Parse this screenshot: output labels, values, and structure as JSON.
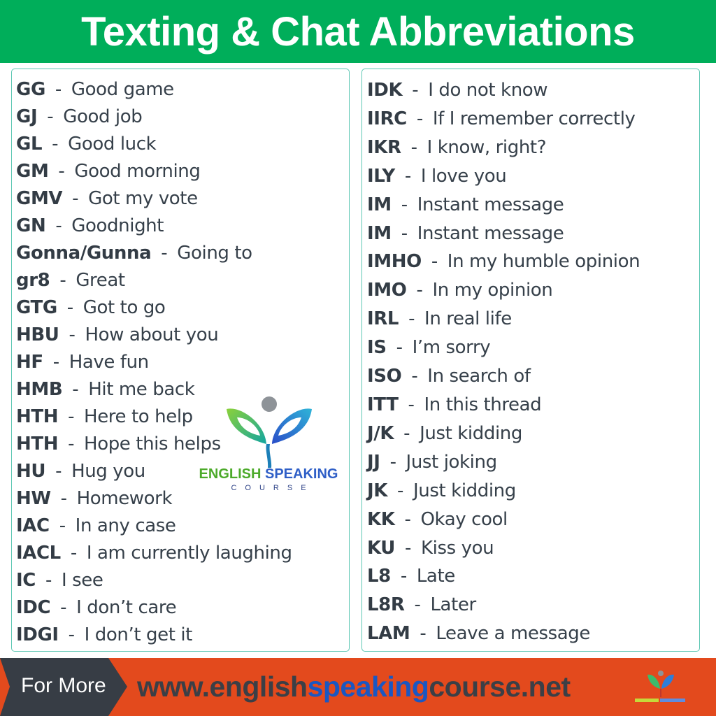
{
  "header": {
    "title": "Texting & Chat Abbreviations"
  },
  "columns": {
    "left": [
      {
        "abbr": "GG",
        "meaning": "Good game"
      },
      {
        "abbr": "GJ",
        "meaning": "Good job"
      },
      {
        "abbr": "GL",
        "meaning": "Good luck"
      },
      {
        "abbr": "GM",
        "meaning": "Good morning"
      },
      {
        "abbr": "GMV",
        "meaning": "Got my vote"
      },
      {
        "abbr": "GN",
        "meaning": "Goodnight"
      },
      {
        "abbr": "Gonna/Gunna",
        "meaning": "Going to"
      },
      {
        "abbr": "gr8",
        "meaning": "Great"
      },
      {
        "abbr": "GTG",
        "meaning": "Got to go"
      },
      {
        "abbr": "HBU",
        "meaning": "How about you"
      },
      {
        "abbr": "HF",
        "meaning": "Have fun"
      },
      {
        "abbr": "HMB",
        "meaning": "Hit me back"
      },
      {
        "abbr": "HTH",
        "meaning": "Here to help"
      },
      {
        "abbr": "HTH",
        "meaning": "Hope this helps"
      },
      {
        "abbr": "HU",
        "meaning": "Hug you"
      },
      {
        "abbr": "HW",
        "meaning": "Homework"
      },
      {
        "abbr": "IAC",
        "meaning": "In any case"
      },
      {
        "abbr": "IACL",
        "meaning": "I am currently laughing"
      },
      {
        "abbr": "IC",
        "meaning": "I see"
      },
      {
        "abbr": "IDC",
        "meaning": "I don’t care"
      },
      {
        "abbr": "IDGI",
        "meaning": "I don’t get it"
      }
    ],
    "right": [
      {
        "abbr": "IDK",
        "meaning": "I do not know"
      },
      {
        "abbr": "IIRC",
        "meaning": "If I remember correctly"
      },
      {
        "abbr": "IKR",
        "meaning": "I know, right?"
      },
      {
        "abbr": "ILY",
        "meaning": "I love you"
      },
      {
        "abbr": "IM",
        "meaning": "Instant message"
      },
      {
        "abbr": "IM",
        "meaning": "Instant message"
      },
      {
        "abbr": "IMHO",
        "meaning": "In my humble opinion"
      },
      {
        "abbr": "IMO",
        "meaning": "In my opinion"
      },
      {
        "abbr": "IRL",
        "meaning": "In real life"
      },
      {
        "abbr": "IS",
        "meaning": "I’m sorry"
      },
      {
        "abbr": "ISO",
        "meaning": "In search of"
      },
      {
        "abbr": "ITT",
        "meaning": "In this thread"
      },
      {
        "abbr": "J/K",
        "meaning": "Just kidding"
      },
      {
        "abbr": "JJ",
        "meaning": "Just joking"
      },
      {
        "abbr": "JK",
        "meaning": "Just kidding"
      },
      {
        "abbr": "KK",
        "meaning": "Okay cool"
      },
      {
        "abbr": "KU",
        "meaning": "Kiss you"
      },
      {
        "abbr": "L8",
        "meaning": "Late"
      },
      {
        "abbr": "L8R",
        "meaning": "Later"
      },
      {
        "abbr": "LAM",
        "meaning": "Leave a message"
      }
    ],
    "separator": "-"
  },
  "logo": {
    "word1": "ENGLISH",
    "word2": "SPEAKING",
    "subtitle": "COURSE"
  },
  "footer": {
    "for_more": "For More",
    "url_prefix": "www.english",
    "url_highlight": "speaking",
    "url_suffix": "course.net"
  },
  "colors": {
    "header_bg": "#00ae5a",
    "footer_bg": "#e34a1d",
    "panel_border": "#5cc7b3",
    "url_highlight": "#1a57c2",
    "for_more_bg": "#373d45"
  }
}
